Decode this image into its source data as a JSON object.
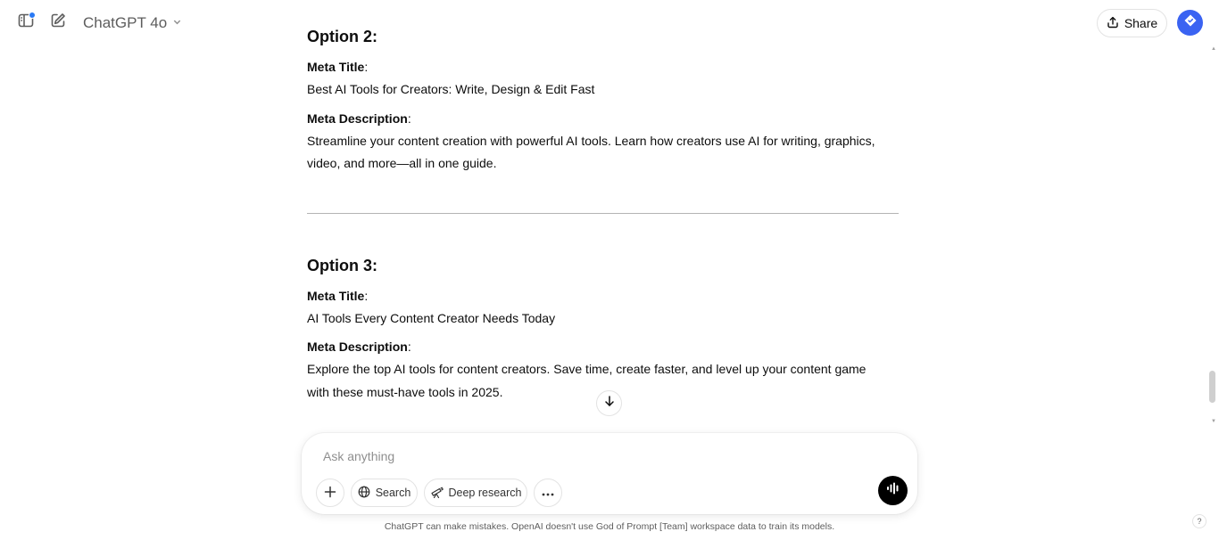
{
  "header": {
    "model_name": "ChatGPT 4o",
    "share_label": "Share"
  },
  "content": {
    "option2": {
      "heading": "Option 2:",
      "title_label": "Meta Title",
      "title_text": "Best AI Tools for Creators: Write, Design & Edit Fast",
      "desc_label": "Meta Description",
      "desc_line1": "Streamline your content creation with powerful AI tools. Learn how creators use AI for writing, graphics,",
      "desc_line2": "video, and more—all in one guide."
    },
    "option3": {
      "heading": "Option 3:",
      "title_label": "Meta Title",
      "title_text": "AI Tools Every Content Creator Needs Today",
      "desc_label": "Meta Description",
      "desc_line1": "Explore the top AI tools for content creators. Save time, create faster, and level up your content game",
      "desc_line2": "with these must-have tools in 2025."
    },
    "colon": ":"
  },
  "composer": {
    "placeholder": "Ask anything",
    "search_label": "Search",
    "deep_research_label": "Deep research"
  },
  "footer": {
    "disclaimer": "ChatGPT can make mistakes. OpenAI doesn't use God of Prompt [Team] workspace data to train its models.",
    "help_label": "?"
  },
  "colors": {
    "accent": "#3a63f2",
    "notification": "#2a7af5",
    "voice_button": "#000000"
  },
  "icons": [
    "sidebar-icon",
    "new-chat-icon",
    "chevron-down-icon",
    "share-icon",
    "avatar-icon",
    "arrow-down-icon",
    "plus-icon",
    "globe-icon",
    "telescope-icon",
    "more-icon",
    "voice-icon"
  ]
}
